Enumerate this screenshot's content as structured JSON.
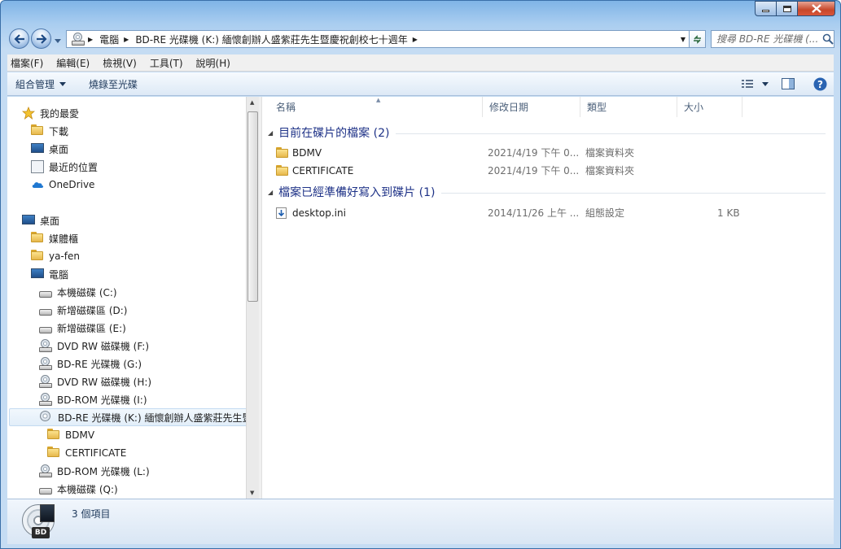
{
  "address": {
    "segments": [
      "電腦",
      "BD-RE 光碟機 (K:) 緬懷創辦人盛紫莊先生暨慶祝創校七十週年"
    ]
  },
  "search": {
    "placeholder": "搜尋 BD-RE 光碟機 (..."
  },
  "menu": [
    "檔案(F)",
    "編輯(E)",
    "檢視(V)",
    "工具(T)",
    "說明(H)"
  ],
  "toolbar": {
    "organize": "組合管理",
    "burn": "燒錄至光碟"
  },
  "sidebar": {
    "favorites": {
      "label": "我的最愛",
      "items": [
        "下載",
        "桌面",
        "最近的位置",
        "OneDrive"
      ]
    },
    "desktop": {
      "label": "桌面"
    },
    "items": [
      "媒體櫃",
      "ya-fen",
      "電腦"
    ],
    "drives": [
      "本機磁碟 (C:)",
      "新增磁碟區 (D:)",
      "新增磁碟區 (E:)",
      "DVD RW 磁碟機 (F:)",
      "BD-RE 光碟機 (G:)",
      "DVD RW 磁碟機 (H:)",
      "BD-ROM 光碟機 (I:)",
      "BD-RE 光碟機 (K:) 緬懷創辦人盛紫莊先生暨",
      "BDMV",
      "CERTIFICATE",
      "BD-ROM 光碟機 (L:)",
      "本機磁碟 (Q:)"
    ]
  },
  "columns": [
    "名稱",
    "修改日期",
    "類型",
    "大小"
  ],
  "groups": [
    {
      "title": "目前在碟片的檔案 (2)",
      "files": [
        {
          "name": "BDMV",
          "date": "2021/4/19 下午 0...",
          "type": "檔案資料夾",
          "size": ""
        },
        {
          "name": "CERTIFICATE",
          "date": "2021/4/19 下午 0...",
          "type": "檔案資料夾",
          "size": ""
        }
      ]
    },
    {
      "title": "檔案已經準備好寫入到碟片 (1)",
      "files": [
        {
          "name": "desktop.ini",
          "date": "2014/11/26 上午 ...",
          "type": "組態設定",
          "size": "1 KB"
        }
      ]
    }
  ],
  "status": {
    "count": "3 個項目",
    "badge": "BD"
  }
}
